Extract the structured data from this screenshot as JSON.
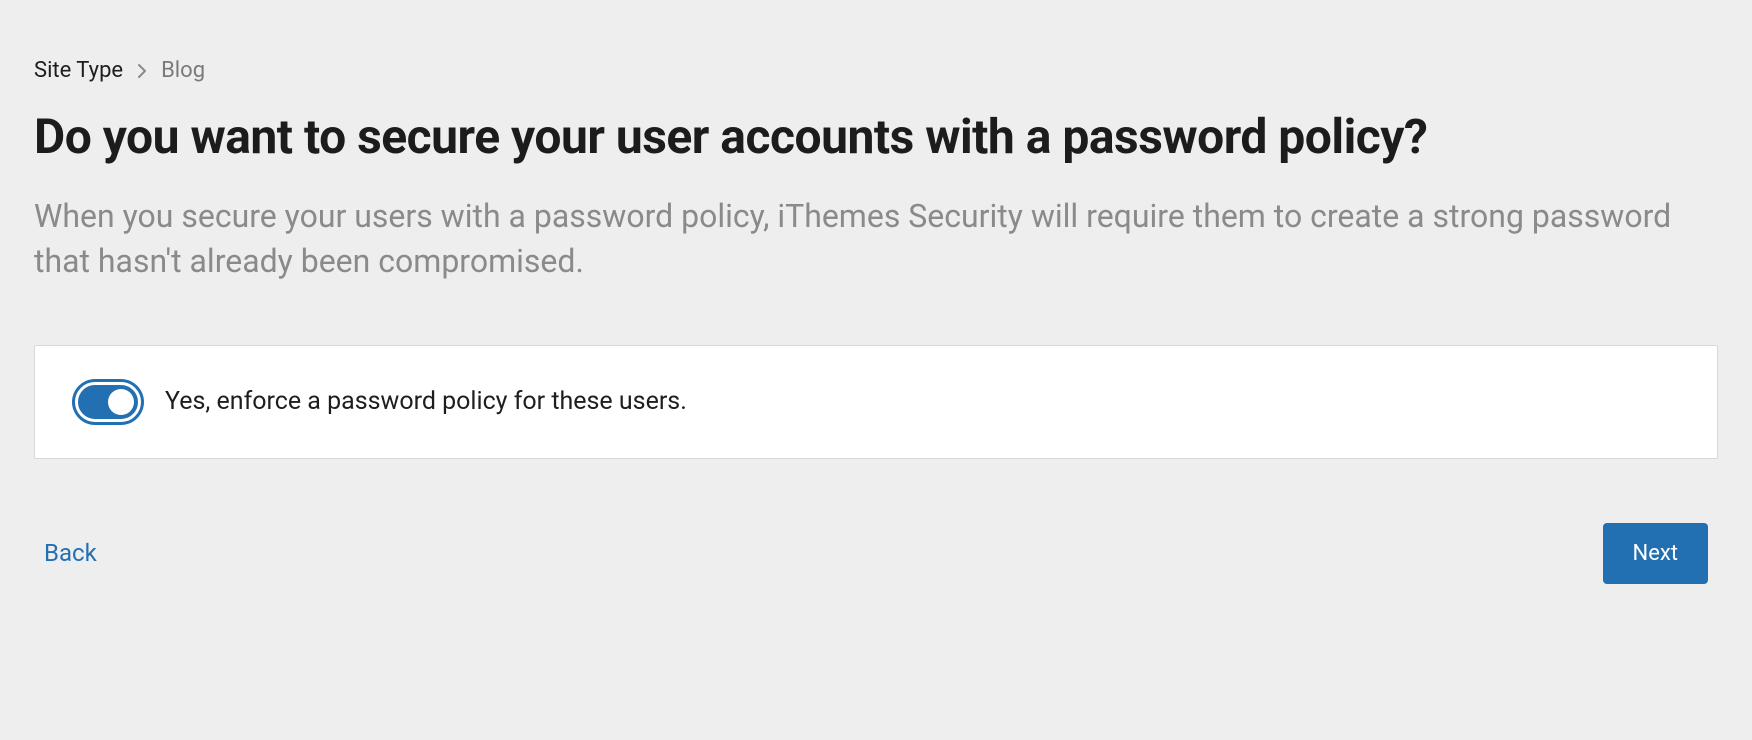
{
  "breadcrumb": {
    "parent": "Site Type",
    "current": "Blog"
  },
  "header": {
    "title": "Do you want to secure your user accounts with a password policy?",
    "subtitle": "When you secure your users with a password policy, iThemes Security will require them to create a strong password that hasn't already been compromised."
  },
  "toggle": {
    "label": "Yes, enforce a password policy for these users."
  },
  "nav": {
    "back": "Back",
    "next": "Next"
  }
}
